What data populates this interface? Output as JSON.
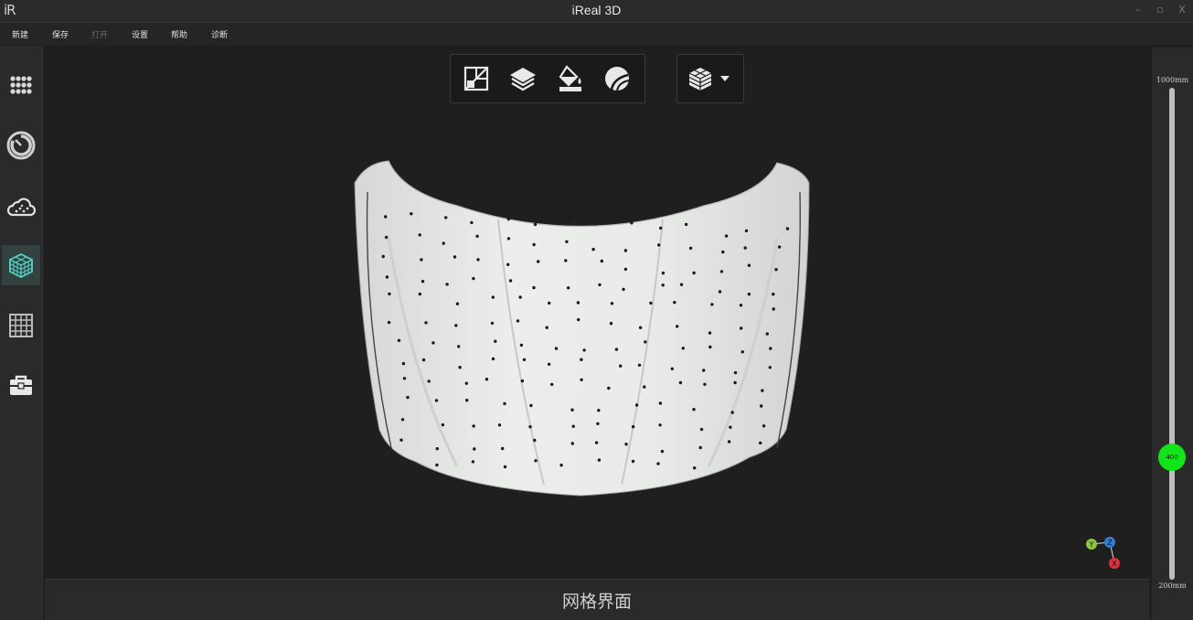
{
  "window": {
    "logo_text": "iR",
    "title": "iReal 3D",
    "controls": [
      "–",
      "▫",
      "X"
    ]
  },
  "menu": [
    {
      "label": "新建",
      "enabled": true
    },
    {
      "label": "保存",
      "enabled": true
    },
    {
      "label": "打开",
      "enabled": false
    },
    {
      "label": "设置",
      "enabled": true
    },
    {
      "label": "帮助",
      "enabled": true
    },
    {
      "label": "诊断",
      "enabled": true
    }
  ],
  "sidebar": {
    "items": [
      {
        "icon": "dots-grid-icon",
        "active": false
      },
      {
        "icon": "scan-dial-icon",
        "active": false
      },
      {
        "icon": "point-cloud-icon",
        "active": false
      },
      {
        "icon": "mesh-cube-icon",
        "active": true
      },
      {
        "icon": "grid-table-icon",
        "active": false
      },
      {
        "icon": "toolbox-icon",
        "active": false
      }
    ]
  },
  "toolbar": {
    "tools": [
      "split-view-icon",
      "layers-icon",
      "fill-bucket-icon",
      "texture-sphere-icon"
    ],
    "display_mode_icon": "cube-layers-icon"
  },
  "axis": {
    "x": "X",
    "y": "Y",
    "z": "Z"
  },
  "status": {
    "text": "网格界面"
  },
  "depth": {
    "max_label": "1000mm",
    "min_label": "200mm",
    "value": 400,
    "min": 200,
    "max": 1000
  },
  "colors": {
    "accent": "#12e41a",
    "active_tab": "#334140",
    "mesh_icon": "#4fd6c8",
    "axis_x": "#e03040",
    "axis_y": "#8cc63f",
    "axis_z": "#2f7fd8"
  }
}
